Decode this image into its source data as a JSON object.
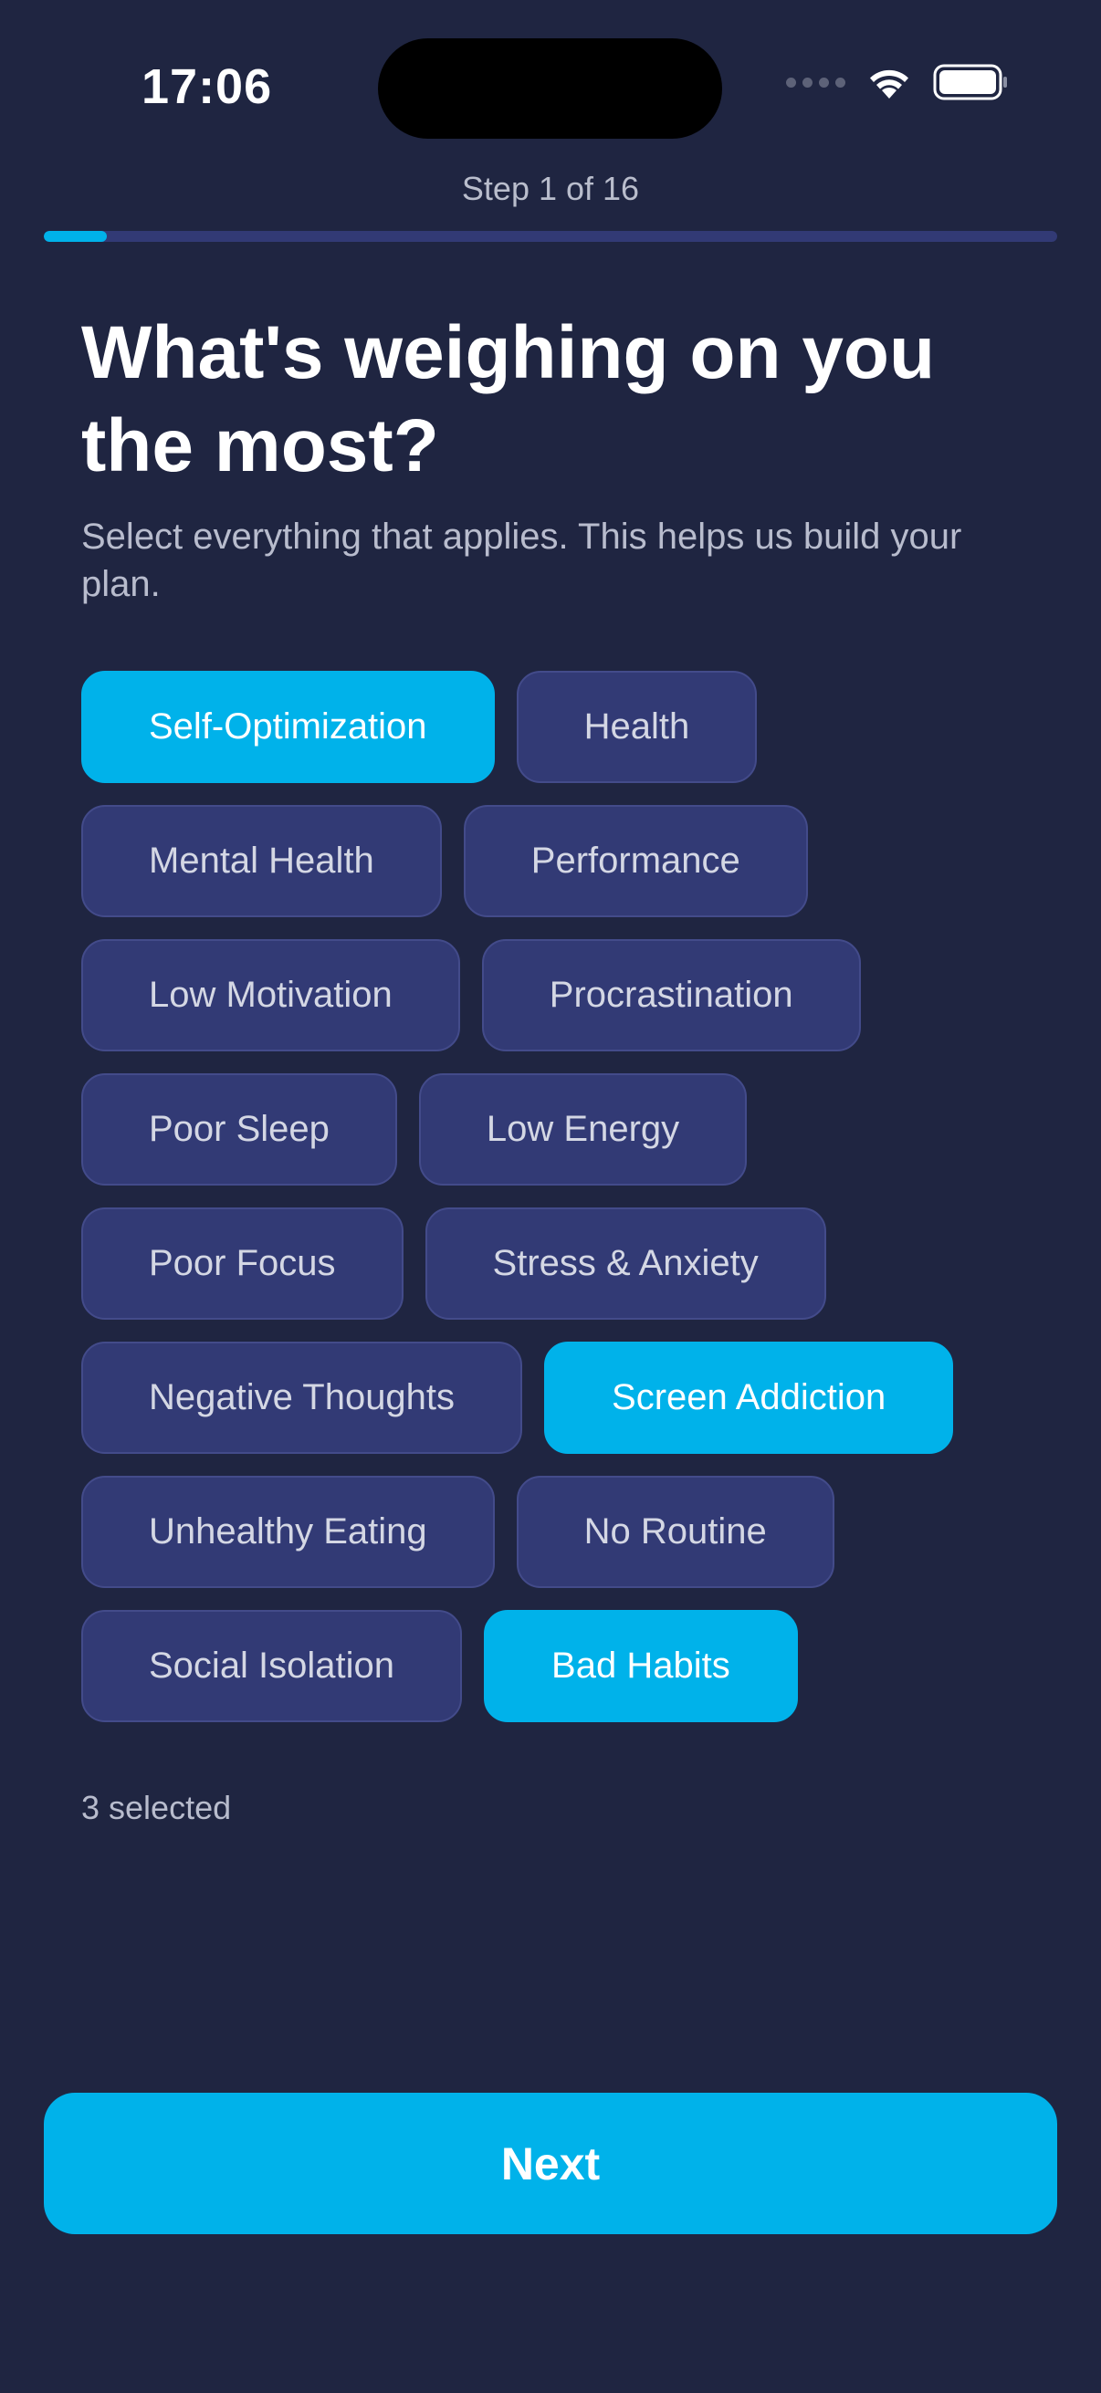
{
  "status_bar": {
    "time": "17:06",
    "icons": [
      "cellular-dots-icon",
      "wifi-icon",
      "battery-icon"
    ]
  },
  "progress": {
    "label": "Step 1 of 16",
    "current": 1,
    "total": 16,
    "fraction": 0.0625
  },
  "heading": {
    "title": "What's weighing on you the most?",
    "subtitle": "Select everything that applies. This helps us build your plan."
  },
  "options": [
    {
      "label": "Self-Optimization",
      "selected": true
    },
    {
      "label": "Health",
      "selected": false
    },
    {
      "label": "Mental Health",
      "selected": false
    },
    {
      "label": "Performance",
      "selected": false
    },
    {
      "label": "Low Motivation",
      "selected": false
    },
    {
      "label": "Procrastination",
      "selected": false
    },
    {
      "label": "Poor Sleep",
      "selected": false
    },
    {
      "label": "Low Energy",
      "selected": false
    },
    {
      "label": "Poor Focus",
      "selected": false
    },
    {
      "label": "Stress & Anxiety",
      "selected": false
    },
    {
      "label": "Negative Thoughts",
      "selected": false
    },
    {
      "label": "Screen Addiction",
      "selected": true
    },
    {
      "label": "Unhealthy Eating",
      "selected": false
    },
    {
      "label": "No Routine",
      "selected": false
    },
    {
      "label": "Social Isolation",
      "selected": false
    },
    {
      "label": "Bad Habits",
      "selected": true
    }
  ],
  "selection_count": "3 selected",
  "next_button": {
    "label": "Next"
  },
  "colors": {
    "background": "#1f2541",
    "chip": "#323a75",
    "accent": "#00b2ea"
  }
}
